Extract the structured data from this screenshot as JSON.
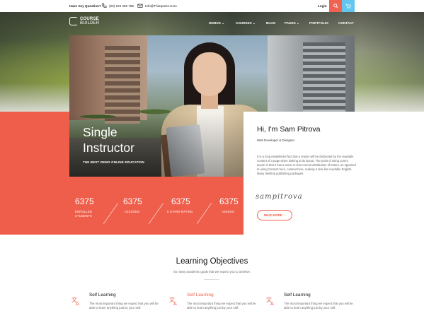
{
  "topbar": {
    "question": "Have Any Question?",
    "phone": "(00) 123 456 789",
    "email": "Info@Thimpress.Com",
    "login": "Login"
  },
  "logo": {
    "line1": "COURSE",
    "line2": "BUILDER"
  },
  "nav": {
    "items": [
      {
        "label": "DEMOS",
        "dropdown": true
      },
      {
        "label": "COURSES",
        "dropdown": true
      },
      {
        "label": "BLOG",
        "dropdown": false
      },
      {
        "label": "PAGES",
        "dropdown": true
      },
      {
        "label": "PORTFOLIO",
        "dropdown": false
      },
      {
        "label": "CONTACT",
        "dropdown": false
      }
    ]
  },
  "hero": {
    "title_line1": "Single",
    "title_line2": "Instructor",
    "subtitle": "THE BEST DEMO ONLINE EDUCATION"
  },
  "stats": [
    {
      "value": "6375",
      "label_line1": "ENROLLED",
      "label_line2": "STUDENTS"
    },
    {
      "value": "6375",
      "label_line1": "LESSONS",
      "label_line2": ""
    },
    {
      "value": "6375",
      "label_line1": "5 STARS RATING",
      "label_line2": ""
    },
    {
      "value": "6375",
      "label_line1": "VIDEOS",
      "label_line2": ""
    }
  ],
  "instructor": {
    "greeting": "Hi, I'm Sam Pitrova",
    "role": "Web Developer &  Designer",
    "description": "It is a long established fact that a reader will be distracted by the readable content of a page when looking at its layout. The point of using Lorem Ipsum is that it has a more-or-less normal distribution of letters, as opposed to using Content here, content here, making it look like readable English. Many desktop publishing packages.",
    "signature": "sampitrova",
    "read_more": "READ MORE"
  },
  "learning": {
    "title": "Learning Objectives",
    "subtitle": "So many academic goals that we expect you to achieve.",
    "features": [
      {
        "title": "Self Learning",
        "text": "The most important thing we expect that you will be able to learn anything just by your self."
      },
      {
        "title": "Self Learning",
        "text": "The most important thing we expect that you will be able to learn anything just by your self."
      },
      {
        "title": "Self Learning",
        "text": "The most important thing we expect that you will be able to learn anything just by your self."
      }
    ]
  },
  "colors": {
    "accent": "#ef5e4b",
    "cart": "#61c7ee"
  }
}
